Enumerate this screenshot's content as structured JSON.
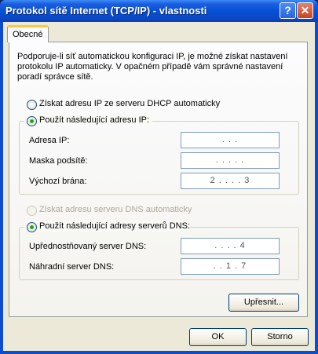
{
  "window": {
    "title": "Protokol sítě Internet (TCP/IP) - vlastnosti"
  },
  "titlebar": {
    "help_glyph": "?",
    "close_glyph": "✕"
  },
  "tab": {
    "label": "Obecné"
  },
  "intro_text": "Podporuje-li síť automatickou konfiguraci IP, je možné získat nastavení protokolu IP automaticky. V opačném případě vám správné nastavení poradí správce sítě.",
  "ip_mode": {
    "auto_label": "Získat adresu IP ze serveru DHCP automaticky",
    "manual_label": "Použít následující adresu IP:",
    "selected": "manual"
  },
  "ip_fields": {
    "address_label": "Adresa IP:",
    "address_value": "  .   .   .  ",
    "mask_label": "Maska podsítě:",
    "mask_value": ". . . . .",
    "gateway_label": "Výchozí brána:",
    "gateway_value": "2 . . . . 3"
  },
  "dns_mode": {
    "auto_label": "Získat adresu serveru DNS automaticky",
    "manual_label": "Použít následující adresy serverů DNS:",
    "selected": "manual",
    "auto_disabled": true
  },
  "dns_fields": {
    "preferred_label": "Upřednostňovaný server DNS:",
    "preferred_value": ". . . . 4",
    "alternate_label": "Náhradní server DNS:",
    "alternate_value": ". . 1 . 7"
  },
  "buttons": {
    "advanced": "Upřesnit...",
    "ok": "OK",
    "cancel": "Storno"
  },
  "colors": {
    "titlebar": "#0550d6",
    "dialog_bg": "#ece9d8",
    "tab_accent": "#ffc83c",
    "radio_dot": "#21a121"
  }
}
